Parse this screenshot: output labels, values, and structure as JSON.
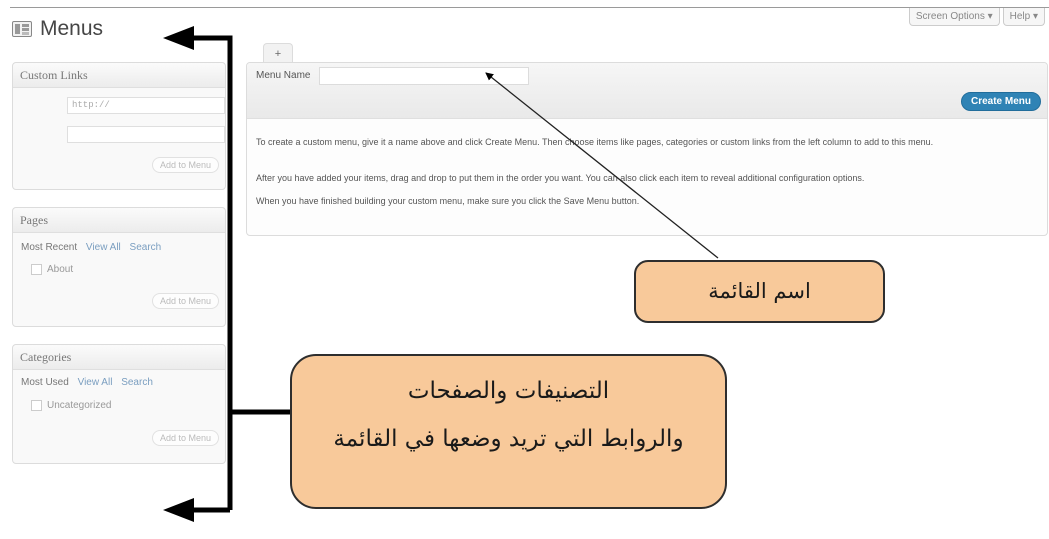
{
  "page": {
    "title": "Menus",
    "menus_icon": "menus-icon",
    "screen_options_label": "Screen Options ▾",
    "help_label": "Help ▾"
  },
  "sidebar": {
    "custom_links": {
      "title": "Custom Links",
      "url_placeholder": "http://",
      "label_value": "",
      "add_label": "Add to Menu"
    },
    "pages": {
      "title": "Pages",
      "tabs": [
        "Most Recent",
        "View All",
        "Search"
      ],
      "items": [
        "About"
      ],
      "add_label": "Add to Menu"
    },
    "categories": {
      "title": "Categories",
      "tabs": [
        "Most Used",
        "View All",
        "Search"
      ],
      "items": [
        "Uncategorized"
      ],
      "add_label": "Add to Menu"
    }
  },
  "editor": {
    "new_tab_label": "+",
    "menu_name_label": "Menu Name",
    "menu_name_value": "",
    "create_button": "Create Menu",
    "instructions": [
      "To create a custom menu, give it a name above and click Create Menu. Then choose items like pages, categories or custom links from the left column to add to this menu.",
      "After you have added your items, drag and drop to put them in the order you want. You can also click each item to reveal additional configuration options.",
      "When you have finished building your custom menu, make sure you click the Save Menu button."
    ]
  },
  "annotations": {
    "menu_name_callout": "اسم القائمة",
    "items_callout_line1": "التصنيفات والصفحات",
    "items_callout_line2": "والروابط التي تريد وضعها في القائمة",
    "fill_color": "#f8c99a",
    "arrow_color": "#000000"
  },
  "colors": {
    "create_button": "#2f83b5",
    "link": "#7a9ec0"
  }
}
